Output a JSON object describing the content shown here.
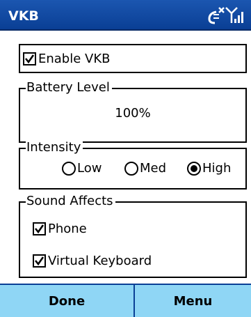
{
  "title_bar": {
    "title": "VKB",
    "status_icons": [
      "connectivity-off-icon",
      "signal-strength-icon"
    ]
  },
  "enable_vkb": {
    "label": "Enable VKB",
    "checked": true
  },
  "battery": {
    "legend": "Battery Level",
    "value": "100%"
  },
  "intensity": {
    "legend": "Intensity",
    "options": [
      {
        "label": "Low",
        "selected": false
      },
      {
        "label": "Med",
        "selected": false
      },
      {
        "label": "High",
        "selected": true
      }
    ]
  },
  "sound_affects": {
    "legend": "Sound Affects",
    "items": [
      {
        "label": "Phone",
        "checked": true
      },
      {
        "label": "Virtual Keyboard",
        "checked": true
      }
    ]
  },
  "softkeys": {
    "left": "Done",
    "right": "Menu"
  },
  "colors": {
    "titlebar": "#0a3f95",
    "softkey_bar": "#8fd6f5",
    "title_text": "#ffffff"
  }
}
